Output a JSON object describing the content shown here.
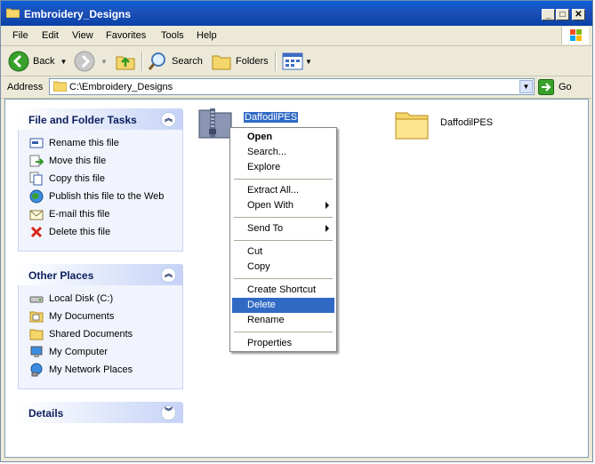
{
  "window": {
    "title": "Embroidery_Designs"
  },
  "menu": [
    "File",
    "Edit",
    "View",
    "Favorites",
    "Tools",
    "Help"
  ],
  "toolbar": {
    "back": "Back",
    "search": "Search",
    "folders": "Folders"
  },
  "address": {
    "label": "Address",
    "value": "C:\\Embroidery_Designs",
    "go": "Go"
  },
  "panels": {
    "file_tasks": {
      "title": "File and Folder Tasks",
      "items": [
        "Rename this file",
        "Move this file",
        "Copy this file",
        "Publish this file to the Web",
        "E-mail this file",
        "Delete this file"
      ]
    },
    "other_places": {
      "title": "Other Places",
      "items": [
        "Local Disk (C:)",
        "My Documents",
        "Shared Documents",
        "My Computer",
        "My Network Places"
      ]
    },
    "details": {
      "title": "Details"
    }
  },
  "files": [
    {
      "name": "DaffodilPES",
      "type": "zip",
      "selected": true
    },
    {
      "name": "DaffodilPES",
      "type": "folder",
      "selected": false
    }
  ],
  "context_menu": {
    "items": [
      "Open",
      "Search...",
      "Explore",
      "Extract All...",
      "Open With",
      "Send To",
      "Cut",
      "Copy",
      "Create Shortcut",
      "Delete",
      "Rename",
      "Properties"
    ],
    "highlighted": "Delete"
  },
  "colors": {
    "title_bar": "#0a5fd8",
    "selection": "#316ac5",
    "panel_header_text": "#0c1f5e"
  }
}
